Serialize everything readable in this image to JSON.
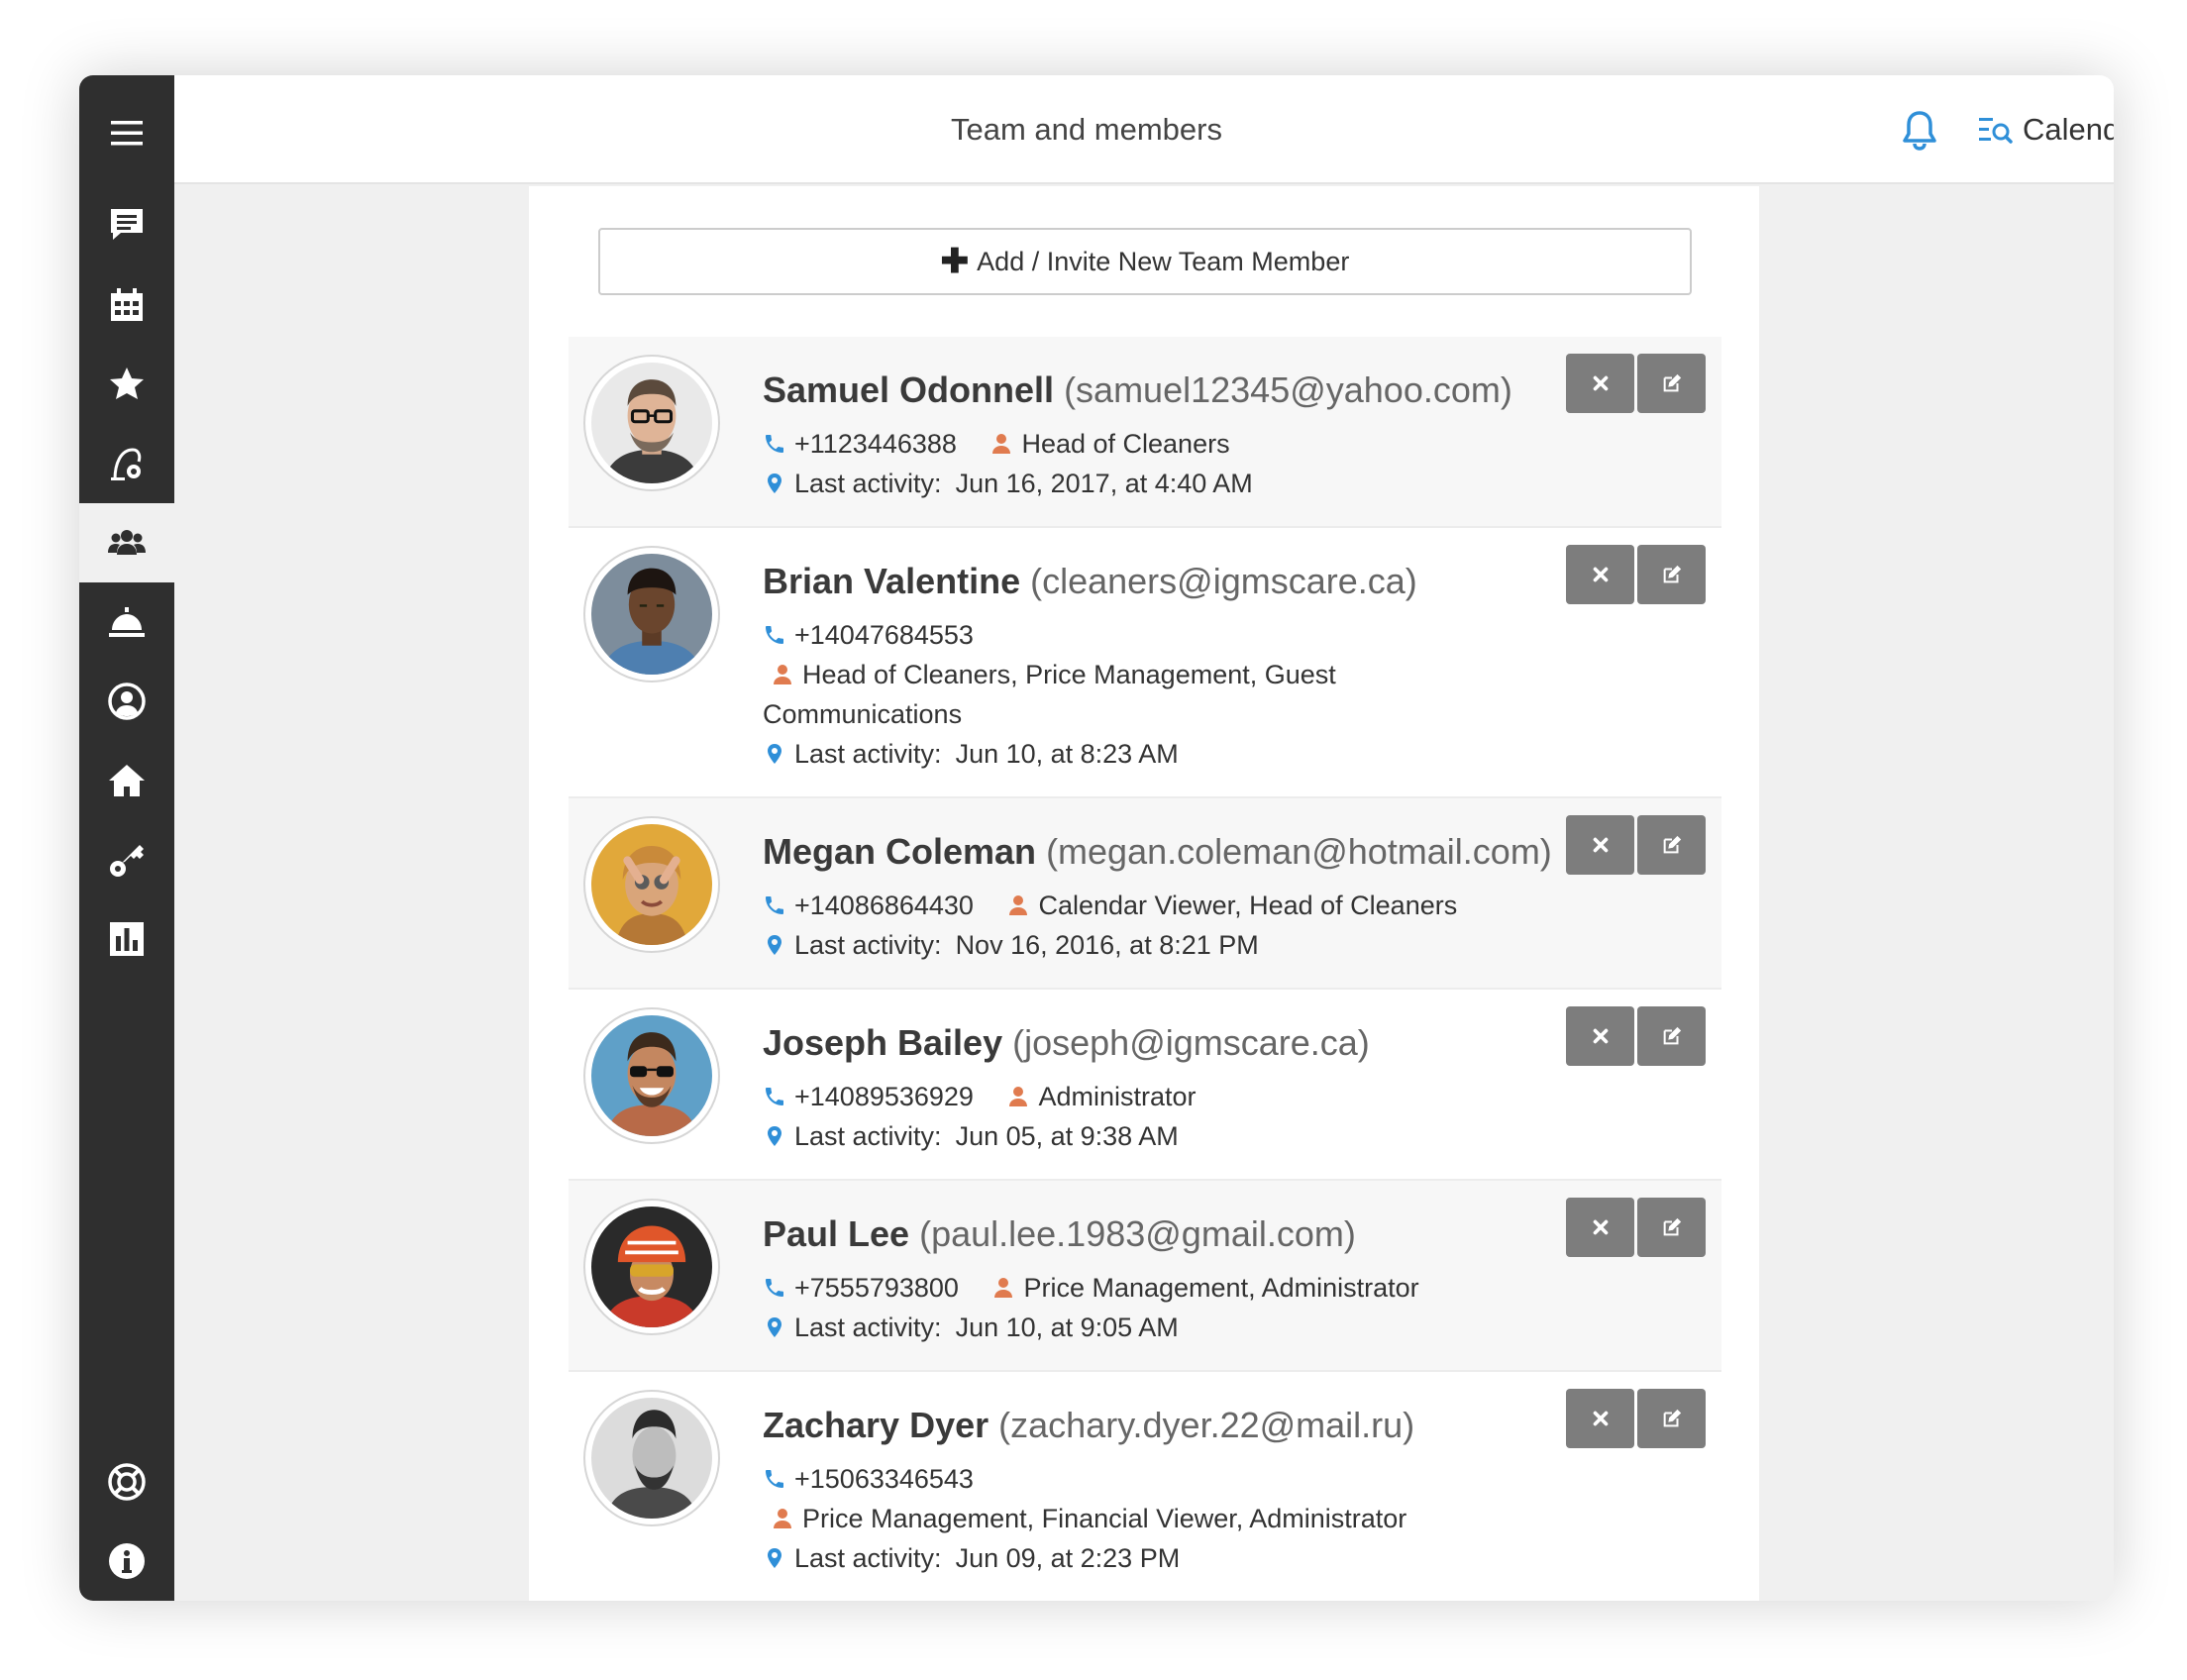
{
  "header": {
    "title": "Team and members",
    "calendar_label": "Calendar"
  },
  "sidebar": {
    "items": [
      {
        "icon": "menu-icon"
      },
      {
        "icon": "chat-icon"
      },
      {
        "icon": "calendar-icon"
      },
      {
        "icon": "star-icon"
      },
      {
        "icon": "vacuum-icon"
      },
      {
        "icon": "team-icon",
        "active": true
      },
      {
        "icon": "service-bell-icon"
      },
      {
        "icon": "user-circle-icon"
      },
      {
        "icon": "home-icon"
      },
      {
        "icon": "key-icon"
      },
      {
        "icon": "bar-chart-icon"
      },
      {
        "icon": "lifebuoy-icon"
      },
      {
        "icon": "info-icon"
      }
    ]
  },
  "add_button": {
    "label": "Add / Invite New Team Member"
  },
  "labels": {
    "last_activity": "Last activity:"
  },
  "members": [
    {
      "name": "Samuel Odonnell",
      "email": "(samuel12345@yahoo.com)",
      "phone": "+1123446388",
      "roles": "Head of Cleaners",
      "last_activity": "Jun 16, 2017, at 4:40 AM"
    },
    {
      "name": "Brian Valentine",
      "email": "(cleaners@igmscare.ca)",
      "phone": "+14047684553",
      "roles": "Head of Cleaners, Price Management, Guest Communications",
      "last_activity": "Jun 10, at 8:23 AM"
    },
    {
      "name": "Megan Coleman",
      "email": "(megan.coleman@hotmail.com)",
      "phone": "+14086864430",
      "roles": "Calendar Viewer, Head of Cleaners",
      "last_activity": "Nov 16, 2016, at 8:21 PM"
    },
    {
      "name": "Joseph Bailey",
      "email": "(joseph@igmscare.ca)",
      "phone": "+14089536929",
      "roles": "Administrator",
      "last_activity": "Jun 05, at 9:38 AM"
    },
    {
      "name": "Paul Lee",
      "email": "(paul.lee.1983@gmail.com)",
      "phone": "+7555793800",
      "roles": "Price Management, Administrator",
      "last_activity": "Jun 10, at 9:05 AM"
    },
    {
      "name": "Zachary Dyer",
      "email": "(zachary.dyer.22@mail.ru)",
      "phone": "+15063346543",
      "roles": "Price Management, Financial Viewer, Administrator",
      "last_activity": "Jun 09, at 2:23 PM"
    }
  ],
  "colors": {
    "sidebar_bg": "#2f2f2f",
    "accent_blue": "#2f8fd8",
    "role_orange": "#e07b4f",
    "action_button": "#7d7d7d"
  }
}
